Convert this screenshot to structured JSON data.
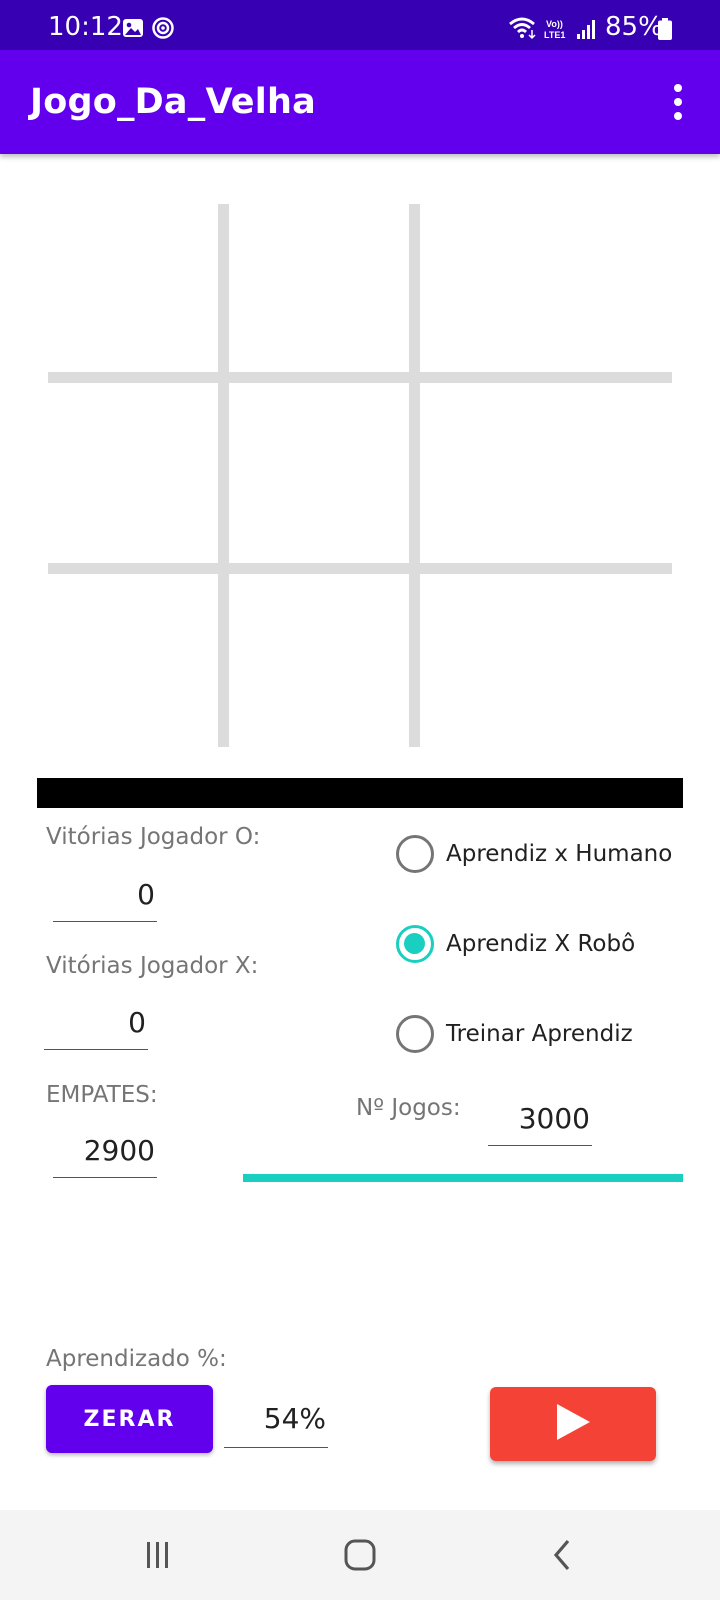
{
  "status": {
    "time": "10:12",
    "battery_pct": "85%",
    "icons": [
      "gallery-icon",
      "sync-circle-icon",
      "wifi-icon",
      "volte-lte-icon",
      "signal-icon",
      "battery-icon"
    ]
  },
  "app_bar": {
    "title": "Jogo_Da_Velha",
    "menu_icon": "more-vert-icon"
  },
  "board": {
    "cells": [
      "",
      "",
      "",
      "",
      "",
      "",
      "",
      "",
      ""
    ],
    "line_color": "#dcdcdc"
  },
  "stats": {
    "wins_o_label": "Vitórias Jogador O:",
    "wins_o_value": "0",
    "wins_x_label": "Vitórias Jogador X:",
    "wins_x_value": "0",
    "draws_label": "EMPATES:",
    "draws_value": "2900"
  },
  "modes": {
    "options": [
      {
        "label": "Aprendiz x Humano",
        "checked": false
      },
      {
        "label": "Aprendiz X Robô",
        "checked": true
      },
      {
        "label": "Treinar Aprendiz",
        "checked": false
      }
    ],
    "accent": "#18cfc0"
  },
  "games": {
    "label": "Nº Jogos:",
    "value": "3000",
    "progress": 1.0
  },
  "learning": {
    "label": "Aprendizado %:",
    "value": "54%"
  },
  "buttons": {
    "reset_label": "ZERAR",
    "play_icon": "play-icon",
    "reset_color": "#6200ee",
    "play_color": "#f44336"
  },
  "nav": {
    "icons": [
      "recents-icon",
      "home-icon",
      "back-icon"
    ]
  }
}
